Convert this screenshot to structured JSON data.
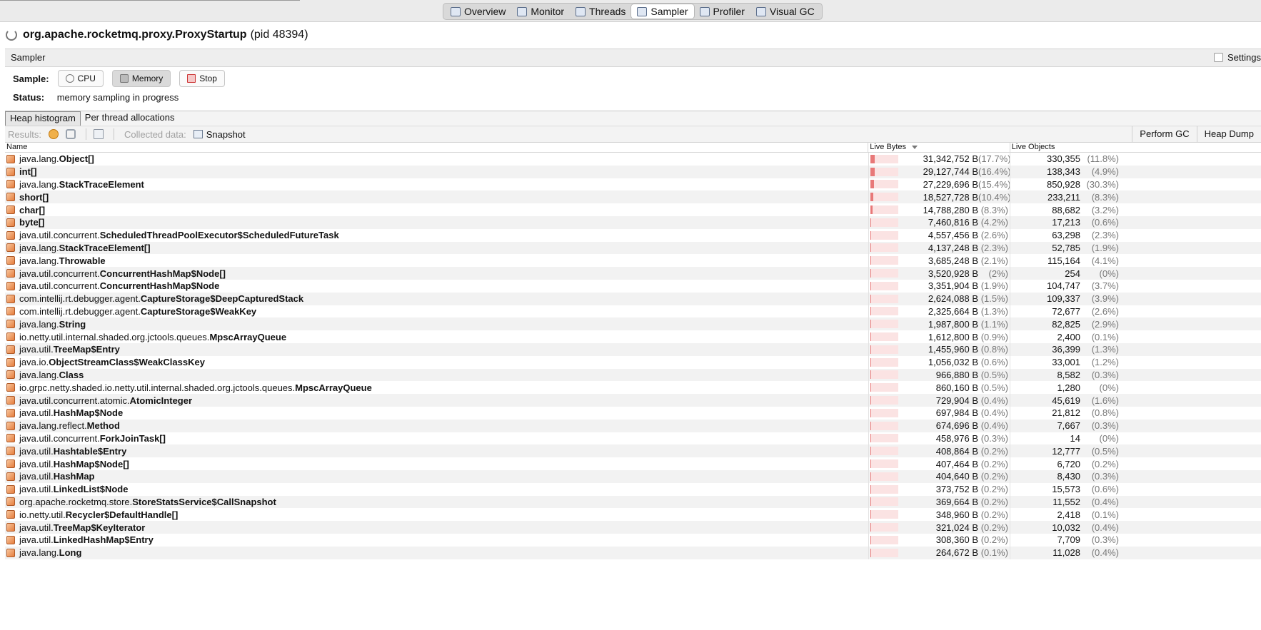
{
  "top_tabs": [
    {
      "label": "Overview",
      "icon": "overview-icon"
    },
    {
      "label": "Monitor",
      "icon": "monitor-icon"
    },
    {
      "label": "Threads",
      "icon": "threads-icon"
    },
    {
      "label": "Sampler",
      "icon": "sampler-icon",
      "active": true
    },
    {
      "label": "Profiler",
      "icon": "profiler-icon"
    },
    {
      "label": "Visual GC",
      "icon": "visual-gc-icon"
    }
  ],
  "app": {
    "main_class": "org.apache.rocketmq.proxy.ProxyStartup",
    "pid": "(pid 48394)"
  },
  "panel": {
    "title": "Sampler",
    "settings_label": "Settings"
  },
  "sample": {
    "label": "Sample:",
    "cpu": "CPU",
    "memory": "Memory",
    "stop": "Stop"
  },
  "status": {
    "label": "Status:",
    "value": "memory sampling in progress"
  },
  "subtabs": {
    "heap": "Heap histogram",
    "per_thread": "Per thread allocations"
  },
  "toolbar": {
    "results": "Results:",
    "collected": "Collected data:",
    "snapshot": "Snapshot",
    "perform_gc": "Perform GC",
    "heap_dump": "Heap Dump"
  },
  "columns": {
    "name": "Name",
    "live_bytes": "Live Bytes",
    "live_objects": "Live Objects"
  },
  "colors": {
    "bar_fill": "#e87878",
    "bar_bg": "#fbe3e3"
  },
  "rows": [
    {
      "pkg": "java.lang.",
      "cls": "Object[]",
      "bytes": "31,342,752 B",
      "bpct": "(17.7%)",
      "bfrac": 0.177,
      "objs": "330,355",
      "opct": "(11.8%)"
    },
    {
      "pkg": "",
      "cls": "int[]",
      "bytes": "29,127,744 B",
      "bpct": "(16.4%)",
      "bfrac": 0.164,
      "objs": "138,343",
      "opct": "(4.9%)"
    },
    {
      "pkg": "java.lang.",
      "cls": "StackTraceElement",
      "bytes": "27,229,696 B",
      "bpct": "(15.4%)",
      "bfrac": 0.154,
      "objs": "850,928",
      "opct": "(30.3%)"
    },
    {
      "pkg": "",
      "cls": "short[]",
      "bytes": "18,527,728 B",
      "bpct": "(10.4%)",
      "bfrac": 0.104,
      "objs": "233,211",
      "opct": "(8.3%)"
    },
    {
      "pkg": "",
      "cls": "char[]",
      "bytes": "14,788,280 B",
      "bpct": "(8.3%)",
      "bfrac": 0.083,
      "objs": "88,682",
      "opct": "(3.2%)"
    },
    {
      "pkg": "",
      "cls": "byte[]",
      "bytes": "7,460,816 B",
      "bpct": "(4.2%)",
      "bfrac": 0.042,
      "objs": "17,213",
      "opct": "(0.6%)"
    },
    {
      "pkg": "java.util.concurrent.",
      "cls": "ScheduledThreadPoolExecutor$ScheduledFutureTask",
      "bytes": "4,557,456 B",
      "bpct": "(2.6%)",
      "bfrac": 0.026,
      "objs": "63,298",
      "opct": "(2.3%)"
    },
    {
      "pkg": "java.lang.",
      "cls": "StackTraceElement[]",
      "bytes": "4,137,248 B",
      "bpct": "(2.3%)",
      "bfrac": 0.023,
      "objs": "52,785",
      "opct": "(1.9%)"
    },
    {
      "pkg": "java.lang.",
      "cls": "Throwable",
      "bytes": "3,685,248 B",
      "bpct": "(2.1%)",
      "bfrac": 0.021,
      "objs": "115,164",
      "opct": "(4.1%)"
    },
    {
      "pkg": "java.util.concurrent.",
      "cls": "ConcurrentHashMap$Node[]",
      "bytes": "3,520,928 B",
      "bpct": "(2%)",
      "bfrac": 0.02,
      "objs": "254",
      "opct": "(0%)"
    },
    {
      "pkg": "java.util.concurrent.",
      "cls": "ConcurrentHashMap$Node",
      "bytes": "3,351,904 B",
      "bpct": "(1.9%)",
      "bfrac": 0.019,
      "objs": "104,747",
      "opct": "(3.7%)"
    },
    {
      "pkg": "com.intellij.rt.debugger.agent.",
      "cls": "CaptureStorage$DeepCapturedStack",
      "bytes": "2,624,088 B",
      "bpct": "(1.5%)",
      "bfrac": 0.015,
      "objs": "109,337",
      "opct": "(3.9%)"
    },
    {
      "pkg": "com.intellij.rt.debugger.agent.",
      "cls": "CaptureStorage$WeakKey",
      "bytes": "2,325,664 B",
      "bpct": "(1.3%)",
      "bfrac": 0.013,
      "objs": "72,677",
      "opct": "(2.6%)"
    },
    {
      "pkg": "java.lang.",
      "cls": "String",
      "bytes": "1,987,800 B",
      "bpct": "(1.1%)",
      "bfrac": 0.011,
      "objs": "82,825",
      "opct": "(2.9%)"
    },
    {
      "pkg": "io.netty.util.internal.shaded.org.jctools.queues.",
      "cls": "MpscArrayQueue",
      "bytes": "1,612,800 B",
      "bpct": "(0.9%)",
      "bfrac": 0.009,
      "objs": "2,400",
      "opct": "(0.1%)"
    },
    {
      "pkg": "java.util.",
      "cls": "TreeMap$Entry",
      "bytes": "1,455,960 B",
      "bpct": "(0.8%)",
      "bfrac": 0.008,
      "objs": "36,399",
      "opct": "(1.3%)"
    },
    {
      "pkg": "java.io.",
      "cls": "ObjectStreamClass$WeakClassKey",
      "bytes": "1,056,032 B",
      "bpct": "(0.6%)",
      "bfrac": 0.006,
      "objs": "33,001",
      "opct": "(1.2%)"
    },
    {
      "pkg": "java.lang.",
      "cls": "Class",
      "bytes": "966,880 B",
      "bpct": "(0.5%)",
      "bfrac": 0.005,
      "objs": "8,582",
      "opct": "(0.3%)"
    },
    {
      "pkg": "io.grpc.netty.shaded.io.netty.util.internal.shaded.org.jctools.queues.",
      "cls": "MpscArrayQueue",
      "bytes": "860,160 B",
      "bpct": "(0.5%)",
      "bfrac": 0.005,
      "objs": "1,280",
      "opct": "(0%)"
    },
    {
      "pkg": "java.util.concurrent.atomic.",
      "cls": "AtomicInteger",
      "bytes": "729,904 B",
      "bpct": "(0.4%)",
      "bfrac": 0.004,
      "objs": "45,619",
      "opct": "(1.6%)"
    },
    {
      "pkg": "java.util.",
      "cls": "HashMap$Node",
      "bytes": "697,984 B",
      "bpct": "(0.4%)",
      "bfrac": 0.004,
      "objs": "21,812",
      "opct": "(0.8%)"
    },
    {
      "pkg": "java.lang.reflect.",
      "cls": "Method",
      "bytes": "674,696 B",
      "bpct": "(0.4%)",
      "bfrac": 0.004,
      "objs": "7,667",
      "opct": "(0.3%)"
    },
    {
      "pkg": "java.util.concurrent.",
      "cls": "ForkJoinTask[]",
      "bytes": "458,976 B",
      "bpct": "(0.3%)",
      "bfrac": 0.003,
      "objs": "14",
      "opct": "(0%)"
    },
    {
      "pkg": "java.util.",
      "cls": "Hashtable$Entry",
      "bytes": "408,864 B",
      "bpct": "(0.2%)",
      "bfrac": 0.002,
      "objs": "12,777",
      "opct": "(0.5%)"
    },
    {
      "pkg": "java.util.",
      "cls": "HashMap$Node[]",
      "bytes": "407,464 B",
      "bpct": "(0.2%)",
      "bfrac": 0.002,
      "objs": "6,720",
      "opct": "(0.2%)"
    },
    {
      "pkg": "java.util.",
      "cls": "HashMap",
      "bytes": "404,640 B",
      "bpct": "(0.2%)",
      "bfrac": 0.002,
      "objs": "8,430",
      "opct": "(0.3%)"
    },
    {
      "pkg": "java.util.",
      "cls": "LinkedList$Node",
      "bytes": "373,752 B",
      "bpct": "(0.2%)",
      "bfrac": 0.002,
      "objs": "15,573",
      "opct": "(0.6%)"
    },
    {
      "pkg": "org.apache.rocketmq.store.",
      "cls": "StoreStatsService$CallSnapshot",
      "bytes": "369,664 B",
      "bpct": "(0.2%)",
      "bfrac": 0.002,
      "objs": "11,552",
      "opct": "(0.4%)"
    },
    {
      "pkg": "io.netty.util.",
      "cls": "Recycler$DefaultHandle[]",
      "bytes": "348,960 B",
      "bpct": "(0.2%)",
      "bfrac": 0.002,
      "objs": "2,418",
      "opct": "(0.1%)"
    },
    {
      "pkg": "java.util.",
      "cls": "TreeMap$KeyIterator",
      "bytes": "321,024 B",
      "bpct": "(0.2%)",
      "bfrac": 0.002,
      "objs": "10,032",
      "opct": "(0.4%)"
    },
    {
      "pkg": "java.util.",
      "cls": "LinkedHashMap$Entry",
      "bytes": "308,360 B",
      "bpct": "(0.2%)",
      "bfrac": 0.002,
      "objs": "7,709",
      "opct": "(0.3%)"
    },
    {
      "pkg": "java.lang.",
      "cls": "Long",
      "bytes": "264,672 B",
      "bpct": "(0.1%)",
      "bfrac": 0.001,
      "objs": "11,028",
      "opct": "(0.4%)"
    }
  ]
}
